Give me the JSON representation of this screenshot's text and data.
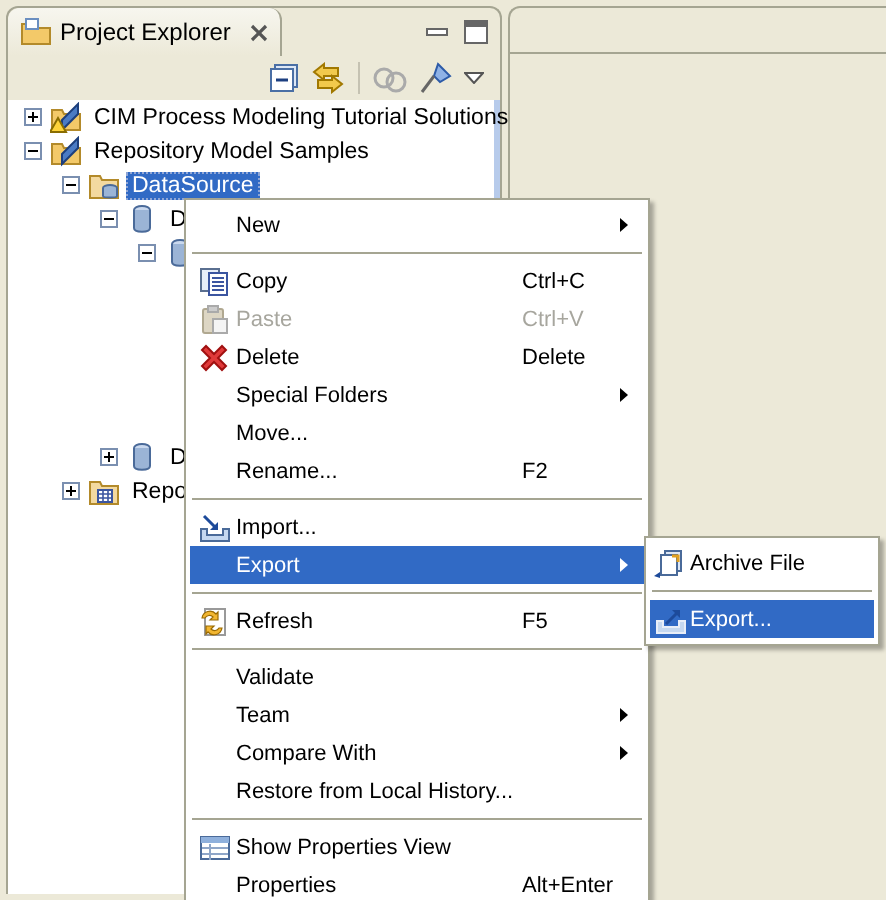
{
  "view": {
    "title": "Project Explorer"
  },
  "tree": [
    {
      "label": "CIM Process Modeling Tutorial Solutions",
      "kind": "warning-project",
      "expanded": false,
      "selected": false
    },
    {
      "label": "Repository Model Samples",
      "kind": "project",
      "expanded": true,
      "selected": false,
      "children": [
        {
          "label": "DataSource",
          "kind": "datasource",
          "expanded": true,
          "selected": true,
          "children": [
            {
              "label": "D",
              "kind": "database",
              "expanded": true,
              "selected": false,
              "children": [
                {
                  "kind": "database",
                  "expanded": true
                }
              ]
            },
            {
              "label": "D",
              "kind": "database",
              "expanded": false,
              "selected": false
            }
          ]
        },
        {
          "label": "Repo",
          "kind": "table-folder",
          "expanded": false,
          "selected": false
        }
      ]
    }
  ],
  "menu": [
    {
      "kind": "item",
      "label": "New",
      "submenu": true,
      "disabled": false,
      "selected": false
    },
    {
      "kind": "separator"
    },
    {
      "kind": "copy",
      "label": "Copy",
      "shortcut": "Ctrl+C",
      "disabled": false,
      "selected": false
    },
    {
      "kind": "paste",
      "label": "Paste",
      "shortcut": "Ctrl+V",
      "disabled": true,
      "selected": false
    },
    {
      "kind": "delete",
      "label": "Delete",
      "shortcut": "Delete",
      "disabled": false,
      "selected": false
    },
    {
      "kind": "item",
      "label": "Special Folders",
      "submenu": true,
      "disabled": false,
      "selected": false
    },
    {
      "kind": "item",
      "label": "Move...",
      "disabled": false,
      "selected": false
    },
    {
      "kind": "item",
      "label": "Rename...",
      "shortcut": "F2",
      "disabled": false,
      "selected": false
    },
    {
      "kind": "separator"
    },
    {
      "kind": "import",
      "label": "Import...",
      "disabled": false,
      "selected": false
    },
    {
      "kind": "item",
      "label": "Export",
      "submenu": true,
      "disabled": false,
      "selected": true
    },
    {
      "kind": "separator"
    },
    {
      "kind": "refresh",
      "label": "Refresh",
      "shortcut": "F5",
      "disabled": false,
      "selected": false
    },
    {
      "kind": "separator"
    },
    {
      "kind": "item",
      "label": "Validate",
      "disabled": false,
      "selected": false
    },
    {
      "kind": "item",
      "label": "Team",
      "submenu": true,
      "disabled": false,
      "selected": false
    },
    {
      "kind": "item",
      "label": "Compare With",
      "submenu": true,
      "disabled": false,
      "selected": false
    },
    {
      "kind": "item",
      "label": "Restore from Local History...",
      "disabled": false,
      "selected": false
    },
    {
      "kind": "separator"
    },
    {
      "kind": "properties",
      "label": "Show Properties View",
      "disabled": false,
      "selected": false
    },
    {
      "kind": "item",
      "label": "Properties",
      "shortcut": "Alt+Enter",
      "disabled": false,
      "selected": false
    }
  ],
  "submenu": [
    {
      "kind": "archive",
      "label": "Archive File",
      "selected": false
    },
    {
      "kind": "separator"
    },
    {
      "kind": "export",
      "label": "Export...",
      "selected": true
    }
  ]
}
